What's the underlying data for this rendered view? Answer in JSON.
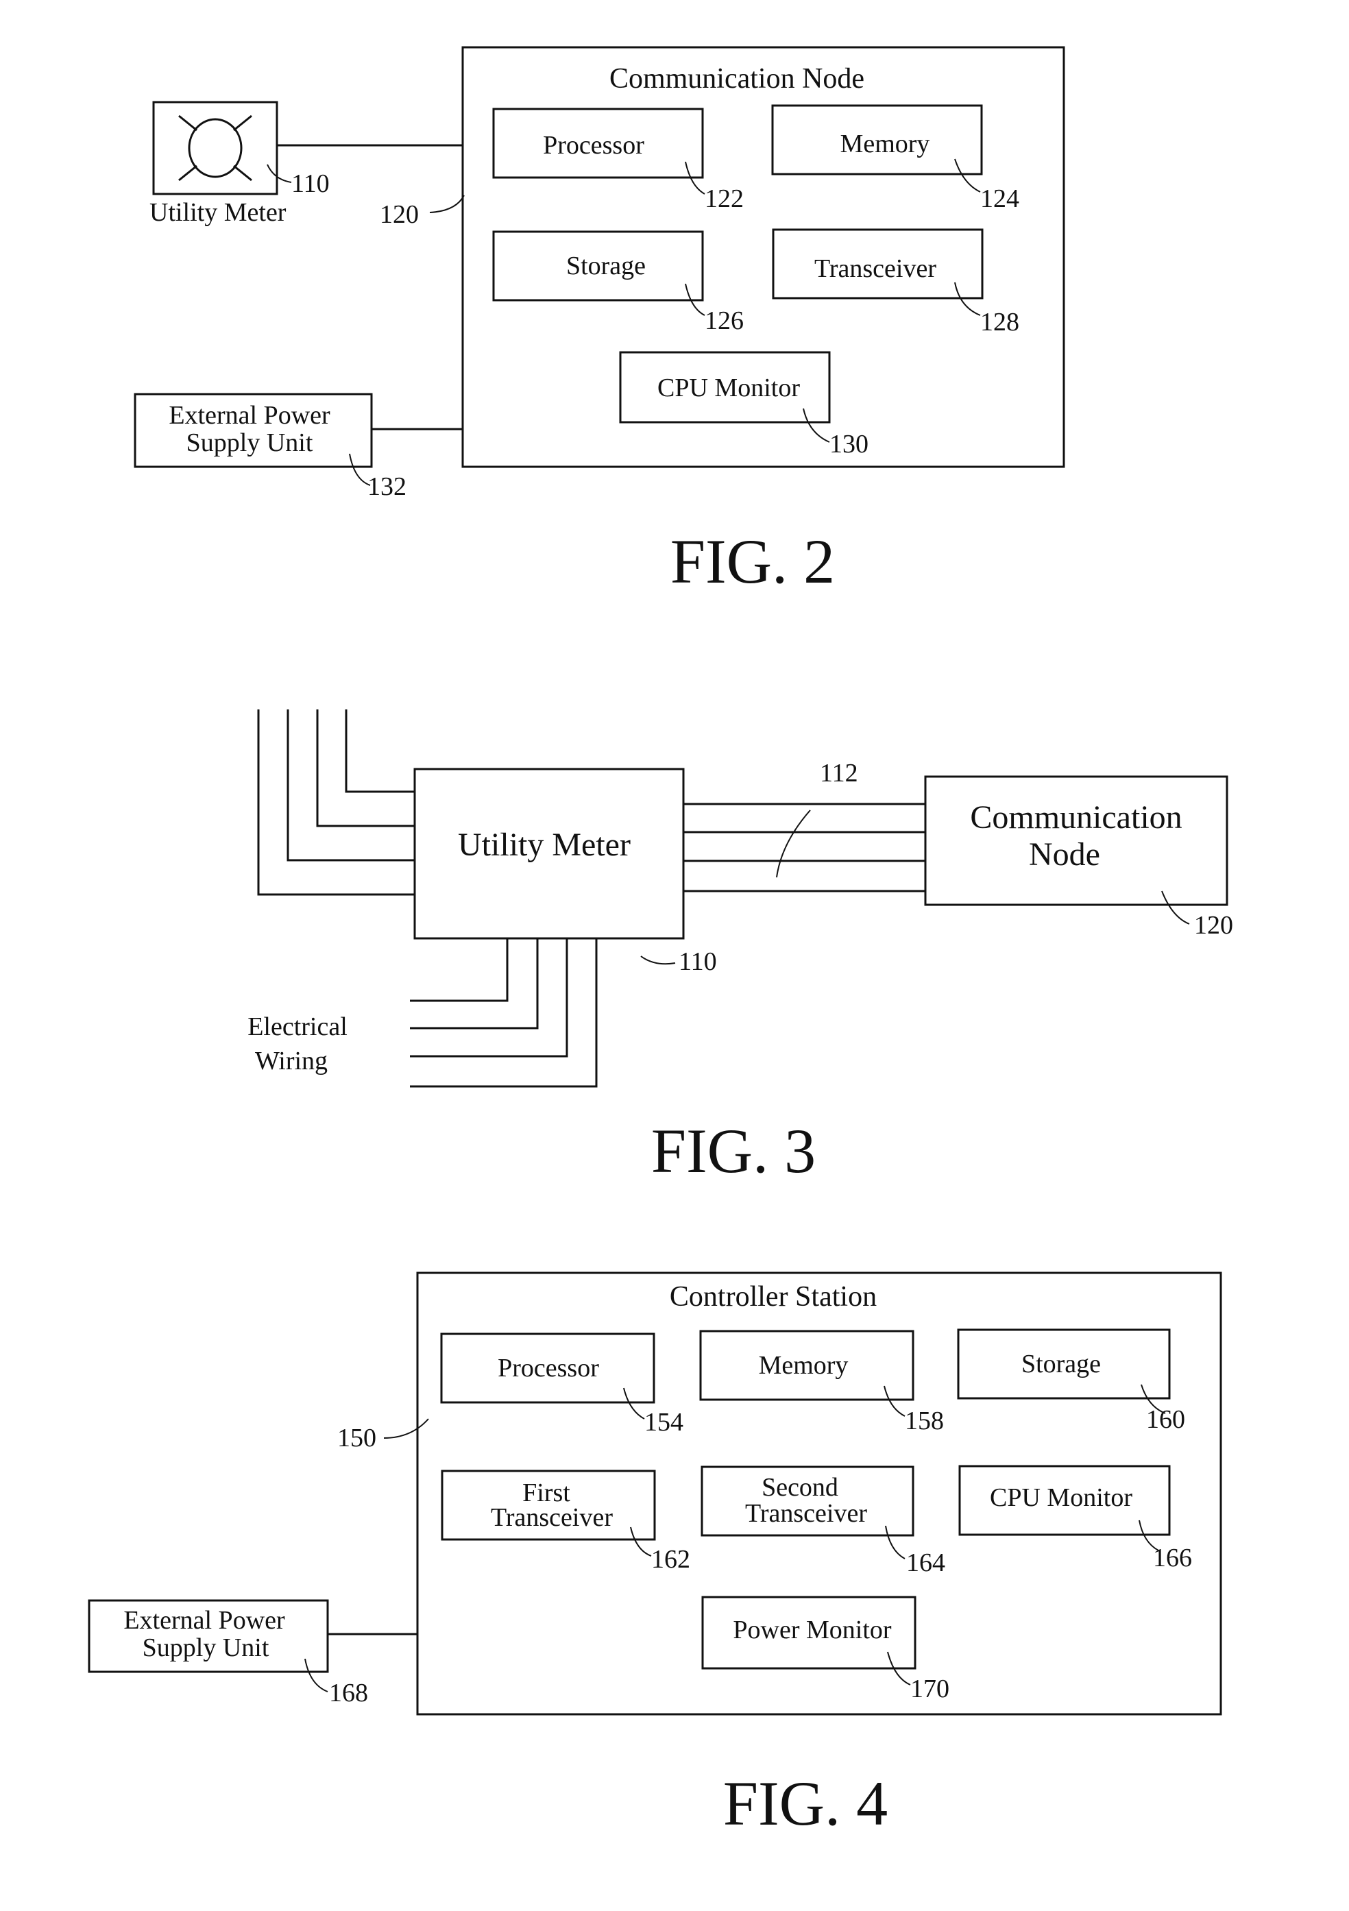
{
  "fig2": {
    "caption": "FIG. 2",
    "utility_meter": {
      "label": "Utility Meter",
      "ref": "110"
    },
    "node": {
      "title": "Communication Node",
      "ref": "120"
    },
    "components": [
      {
        "label": "Processor",
        "ref": "122"
      },
      {
        "label": "Memory",
        "ref": "124"
      },
      {
        "label": "Storage",
        "ref": "126"
      },
      {
        "label": "Transceiver",
        "ref": "128"
      },
      {
        "label": "CPU Monitor",
        "ref": "130"
      }
    ],
    "power": {
      "line1": "External Power",
      "line2": "Supply Unit",
      "ref": "132"
    }
  },
  "fig3": {
    "caption": "FIG. 3",
    "utility_meter": {
      "label": "Utility Meter",
      "ref": "110"
    },
    "connection_ref": "112",
    "node": {
      "line1": "Communication",
      "line2": "Node",
      "ref": "120"
    },
    "wiring": {
      "line1": "Electrical",
      "line2": "Wiring"
    }
  },
  "fig4": {
    "caption": "FIG. 4",
    "station": {
      "title": "Controller Station",
      "ref": "150"
    },
    "components": [
      {
        "line1": "Processor",
        "line2": "",
        "ref": "154"
      },
      {
        "line1": "Memory",
        "line2": "",
        "ref": "158"
      },
      {
        "line1": "Storage",
        "line2": "",
        "ref": "160"
      },
      {
        "line1": "First",
        "line2": "Transceiver",
        "ref": "162"
      },
      {
        "line1": "Second",
        "line2": "Transceiver",
        "ref": "164"
      },
      {
        "line1": "CPU Monitor",
        "line2": "",
        "ref": "166"
      },
      {
        "line1": "Power Monitor",
        "line2": "",
        "ref": "170"
      }
    ],
    "power": {
      "line1": "External Power",
      "line2": "Supply Unit",
      "ref": "168"
    }
  }
}
